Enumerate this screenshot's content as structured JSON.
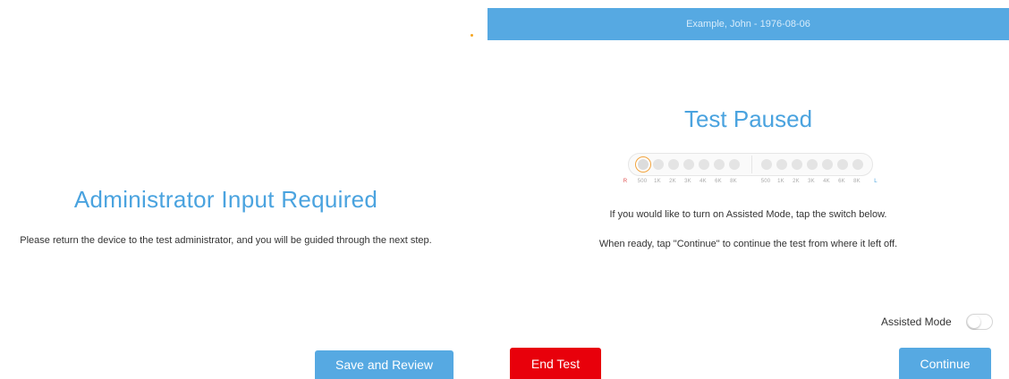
{
  "left": {
    "title": "Administrator Input Required",
    "message": "Please return the device to the test administrator, and you will be guided through the next step.",
    "save_review_label": "Save and Review"
  },
  "right": {
    "header": "Example, John - 1976-08-06",
    "title": "Test Paused",
    "progress": {
      "right_ear_label": "R",
      "left_ear_label": "L",
      "right_freqs": [
        "500",
        "1K",
        "2K",
        "3K",
        "4K",
        "6K",
        "8K"
      ],
      "left_freqs": [
        "500",
        "1K",
        "2K",
        "3K",
        "4K",
        "6K",
        "8K"
      ],
      "active_index": 0
    },
    "message1": "If you would like to turn on Assisted Mode, tap the switch below.",
    "message2": "When ready, tap \"Continue\" to continue the test from where it left off.",
    "assisted_mode_label": "Assisted Mode",
    "assisted_mode_on": false,
    "end_test_label": "End Test",
    "continue_label": "Continue"
  },
  "colors": {
    "accent_blue": "#56a9e2",
    "end_red": "#e8000b",
    "active_ring": "#f2a33c"
  }
}
